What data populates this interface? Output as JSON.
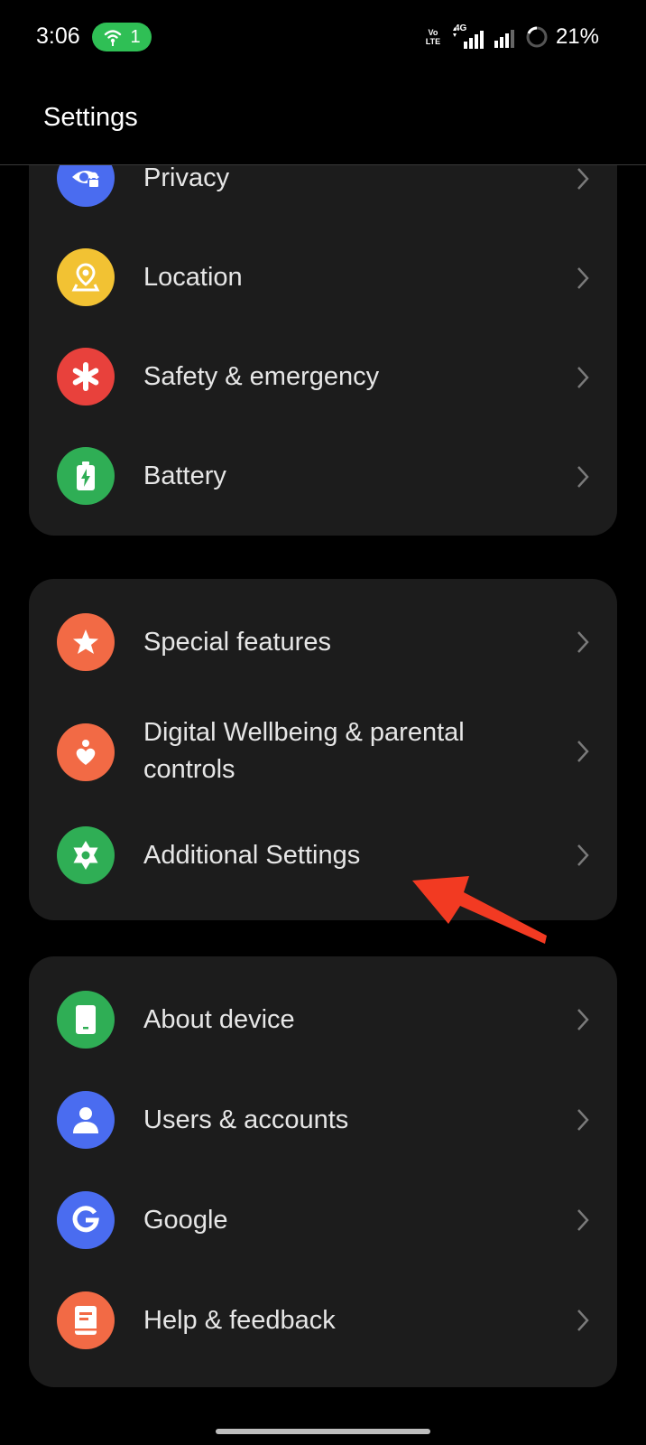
{
  "status_bar": {
    "time": "3:06",
    "hotspot_count": "1",
    "volte_label": "Vo LTE",
    "network_label": "4G",
    "battery_percent": "21%"
  },
  "app_bar": {
    "title": "Settings"
  },
  "cards": [
    {
      "items": [
        {
          "label": "Privacy",
          "icon": "privacy-icon",
          "color": "#4a6cf0"
        },
        {
          "label": "Location",
          "icon": "location-icon",
          "color": "#f2c233"
        },
        {
          "label": "Safety & emergency",
          "icon": "emergency-asterisk-icon",
          "color": "#e8413c"
        },
        {
          "label": "Battery",
          "icon": "battery-icon",
          "color": "#2fae55"
        }
      ]
    },
    {
      "items": [
        {
          "label": "Special features",
          "icon": "star-icon",
          "color": "#f26a45"
        },
        {
          "label": "Digital Wellbeing & parental controls",
          "icon": "wellbeing-heart-icon",
          "color": "#f26a45"
        },
        {
          "label": "Additional Settings",
          "icon": "gear-icon",
          "color": "#2fae55"
        }
      ]
    },
    {
      "items": [
        {
          "label": "About device",
          "icon": "device-icon",
          "color": "#2fae55"
        },
        {
          "label": "Users & accounts",
          "icon": "user-icon",
          "color": "#4a6cf0"
        },
        {
          "label": "Google",
          "icon": "google-icon",
          "color": "#4a6cf0"
        },
        {
          "label": "Help & feedback",
          "icon": "help-book-icon",
          "color": "#f26a45"
        }
      ]
    }
  ],
  "annotation": {
    "color": "#f23a22"
  }
}
